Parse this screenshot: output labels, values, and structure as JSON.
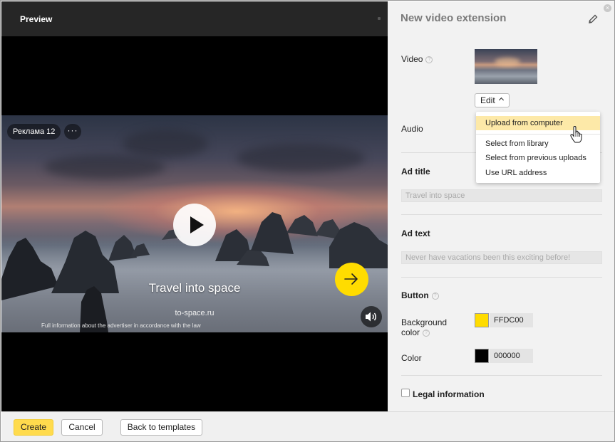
{
  "preview": {
    "header_title": "Preview",
    "ad_badge": "Реклама 12",
    "more_label": "···",
    "video_title": "Travel into space",
    "video_domain": "to-space.ru",
    "legal_text": "Full information about the advertiser in accordance with the law",
    "cta_color": "#FFDC00"
  },
  "panel": {
    "title": "New video extension",
    "close_label": "×",
    "video_label": "Video",
    "audio_label": "Audio",
    "edit_label": "Edit",
    "dropdown": {
      "items": [
        "Upload from computer",
        "Select from library",
        "Select from previous uploads",
        "Use URL address"
      ],
      "highlighted_index": 0
    },
    "ad_title_label": "Ad title",
    "ad_title_placeholder": "Travel into space",
    "ad_text_label": "Ad text",
    "ad_text_placeholder": "Never have vacations been this exciting before!",
    "button_section_label": "Button",
    "background_color_label_1": "Background",
    "background_color_label_2": "color",
    "background_color_value": "FFDC00",
    "background_color_hex": "#FFDC00",
    "color_label": "Color",
    "color_value": "000000",
    "color_hex": "#000000",
    "legal_label": "Legal information"
  },
  "footer": {
    "create_label": "Create",
    "cancel_label": "Cancel",
    "back_label": "Back to templates"
  }
}
